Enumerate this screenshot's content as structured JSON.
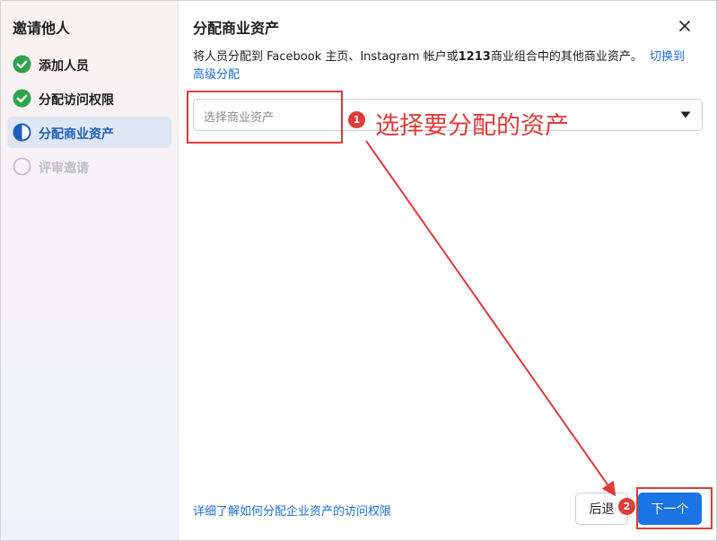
{
  "sidebar": {
    "title": "邀请他人",
    "steps": [
      {
        "label": "添加人员",
        "status": "done",
        "icon": "check-circle-icon"
      },
      {
        "label": "分配访问权限",
        "status": "done",
        "icon": "check-circle-icon"
      },
      {
        "label": "分配商业资产",
        "status": "active",
        "icon": "half-circle-icon"
      },
      {
        "label": "评审邀请",
        "status": "pending",
        "icon": "empty-circle-icon"
      }
    ]
  },
  "main": {
    "title": "分配商业资产",
    "close_icon": "close-icon",
    "description_prefix": "将人员分配到 Facebook 主页、Instagram 帐户或",
    "description_number": "1213",
    "description_suffix": "商业组合中的其他商业资产。",
    "switch_link_line1": "切换到",
    "switch_link_line2": "高级分配",
    "select": {
      "placeholder": "选择商业资产",
      "caret_icon": "caret-down-icon"
    },
    "footer_link": "详细了解如何分配企业资产的访问权限",
    "back_button": "后退",
    "next_button": "下一个"
  },
  "annotations": {
    "badge1": "1",
    "badge2": "2",
    "note1": "选择要分配的资产",
    "color": "#e03a3a"
  },
  "colors": {
    "accent": "#1b74e4",
    "done_check": "#31a24c",
    "active_text": "#1d5fbf",
    "link": "#1d6fd8"
  }
}
